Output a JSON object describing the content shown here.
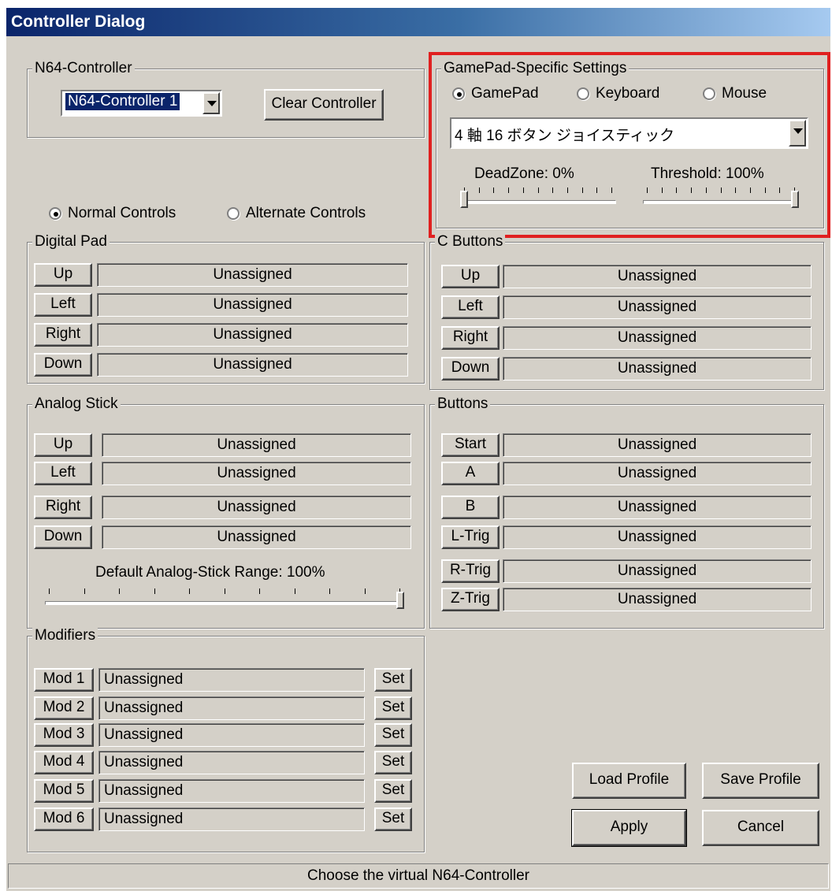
{
  "window": {
    "title": "Controller Dialog"
  },
  "n64_controller": {
    "group_title": "N64-Controller",
    "selected": "N64-Controller 1",
    "clear_label": "Clear Controller"
  },
  "gamepad_settings": {
    "group_title": "GamePad-Specific Settings",
    "radios": [
      "GamePad",
      "Keyboard",
      "Mouse"
    ],
    "selected_radio": "GamePad",
    "device": "4 軸 16 ボタン ジョイスティック",
    "deadzone_label": "DeadZone: 0%",
    "deadzone_value": 0,
    "threshold_label": "Threshold: 100%",
    "threshold_value": 100
  },
  "mode": {
    "normal_label": "Normal Controls",
    "alternate_label": "Alternate Controls",
    "selected": "Normal Controls"
  },
  "digital_pad": {
    "title": "Digital Pad",
    "rows": [
      {
        "label": "Up",
        "value": "Unassigned"
      },
      {
        "label": "Left",
        "value": "Unassigned"
      },
      {
        "label": "Right",
        "value": "Unassigned"
      },
      {
        "label": "Down",
        "value": "Unassigned"
      }
    ]
  },
  "c_buttons": {
    "title": "C Buttons",
    "rows": [
      {
        "label": "Up",
        "value": "Unassigned"
      },
      {
        "label": "Left",
        "value": "Unassigned"
      },
      {
        "label": "Right",
        "value": "Unassigned"
      },
      {
        "label": "Down",
        "value": "Unassigned"
      }
    ]
  },
  "analog_stick": {
    "title": "Analog Stick",
    "rows": [
      {
        "label": "Up",
        "value": "Unassigned"
      },
      {
        "label": "Left",
        "value": "Unassigned"
      },
      {
        "label": "Right",
        "value": "Unassigned"
      },
      {
        "label": "Down",
        "value": "Unassigned"
      }
    ],
    "range_label": "Default Analog-Stick Range: 100%",
    "range_value": 100
  },
  "buttons": {
    "title": "Buttons",
    "rows": [
      {
        "label": "Start",
        "value": "Unassigned"
      },
      {
        "label": "A",
        "value": "Unassigned"
      },
      {
        "label": "B",
        "value": "Unassigned"
      },
      {
        "label": "L-Trig",
        "value": "Unassigned"
      },
      {
        "label": "R-Trig",
        "value": "Unassigned"
      },
      {
        "label": "Z-Trig",
        "value": "Unassigned"
      }
    ]
  },
  "modifiers": {
    "title": "Modifiers",
    "set_label": "Set",
    "rows": [
      {
        "label": "Mod 1",
        "value": "Unassigned"
      },
      {
        "label": "Mod 2",
        "value": "Unassigned"
      },
      {
        "label": "Mod 3",
        "value": "Unassigned"
      },
      {
        "label": "Mod 4",
        "value": "Unassigned"
      },
      {
        "label": "Mod 5",
        "value": "Unassigned"
      },
      {
        "label": "Mod 6",
        "value": "Unassigned"
      }
    ]
  },
  "actions": {
    "load_profile": "Load Profile",
    "save_profile": "Save Profile",
    "apply": "Apply",
    "cancel": "Cancel"
  },
  "status": "Choose the virtual N64-Controller",
  "colors": {
    "title_start": "#0a246a",
    "title_end": "#a6caf0",
    "dialog_bg": "#d4d0c8",
    "highlight": "#e02020"
  }
}
